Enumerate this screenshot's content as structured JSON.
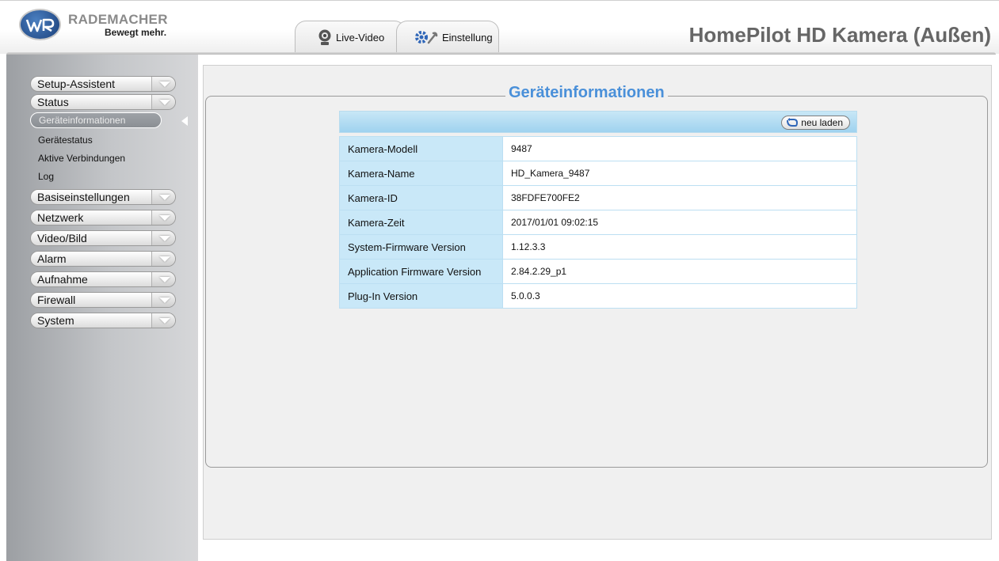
{
  "header": {
    "brand_name": "RADEMACHER",
    "brand_slogan": "Bewegt mehr.",
    "camera_title": "HomePilot HD Kamera (Außen)",
    "tabs": [
      {
        "label": "Live-Video",
        "icon": "webcam-icon"
      },
      {
        "label": "Einstellung",
        "icon": "settings-gear-icon"
      }
    ]
  },
  "sidebar": {
    "menu": [
      {
        "label": "Setup-Assistent"
      },
      {
        "label": "Status",
        "submenu": [
          {
            "label": "Geräteinformationen",
            "active": true
          },
          {
            "label": "Gerätestatus"
          },
          {
            "label": "Aktive Verbindungen"
          },
          {
            "label": "Log"
          }
        ]
      },
      {
        "label": "Basiseinstellungen"
      },
      {
        "label": "Netzwerk"
      },
      {
        "label": "Video/Bild"
      },
      {
        "label": "Alarm"
      },
      {
        "label": "Aufnahme"
      },
      {
        "label": "Firewall"
      },
      {
        "label": "System"
      }
    ]
  },
  "main": {
    "section_title": "Geräteinformationen",
    "reload_label": "neu laden",
    "rows": [
      {
        "key": "Kamera-Modell",
        "value": "9487"
      },
      {
        "key": "Kamera-Name",
        "value": "HD_Kamera_9487"
      },
      {
        "key": "Kamera-ID",
        "value": "38FDFE700FE2"
      },
      {
        "key": "Kamera-Zeit",
        "value": "2017/01/01 09:02:15"
      },
      {
        "key": "System-Firmware Version",
        "value": "1.12.3.3"
      },
      {
        "key": "Application Firmware Version",
        "value": "2.84.2.29_p1"
      },
      {
        "key": "Plug-In Version",
        "value": "5.0.0.3"
      }
    ]
  },
  "colors": {
    "accent": "#4a90d9",
    "table_key_bg": "#c9e8f8",
    "title_gray": "#666666"
  }
}
